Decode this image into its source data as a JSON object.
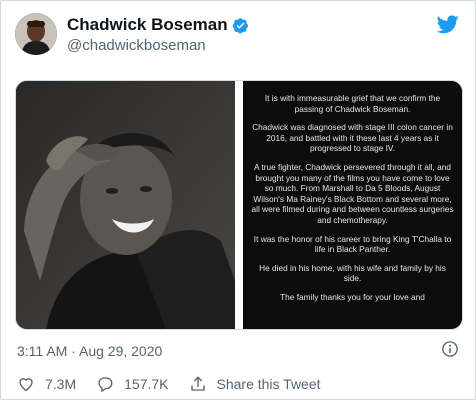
{
  "author": {
    "display_name": "Chadwick Boseman",
    "handle": "@chadwickboseman",
    "verified": true
  },
  "statement": {
    "paragraphs": [
      "It is with immeasurable grief that we confirm the passing of Chadwick Boseman.",
      "Chadwick was diagnosed with stage III colon cancer in 2016, and battled with it these last 4 years as it progressed to stage IV.",
      "A true fighter, Chadwick persevered through it all, and brought you many of the films you have come to love so much. From Marshall to Da 5 Bloods, August Wilson's Ma Rainey's Black Bottom and several more, all were filmed during and between countless surgeries and chemotherapy.",
      "It was the honor of his career to bring King T'Challa to life in Black Panther.",
      "He died in his home, with his wife and family by his side.",
      "The family thanks you for your love and"
    ]
  },
  "tweet": {
    "timestamp": "3:11 AM · Aug 29, 2020"
  },
  "actions": {
    "likes": "7.3M",
    "replies": "157.7K",
    "share_label": "Share this Tweet"
  },
  "colors": {
    "twitter_blue": "#1d9bf0",
    "secondary_text": "#536471",
    "statement_bg": "#0c0c0c"
  },
  "icons": [
    "verified-badge-icon",
    "twitter-bird-icon",
    "info-icon",
    "heart-icon",
    "reply-icon",
    "share-icon"
  ]
}
